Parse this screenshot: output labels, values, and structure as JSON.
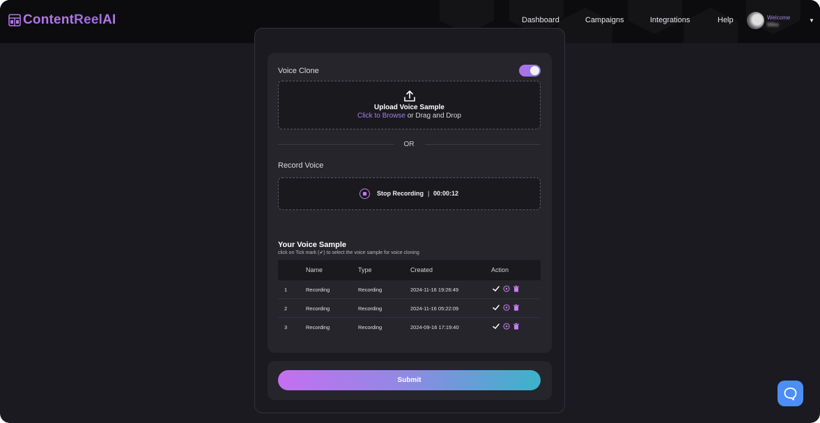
{
  "app": {
    "logo_part1": "Content",
    "logo_part2": "Reel",
    "logo_part3": "AI"
  },
  "nav": {
    "items": [
      "Dashboard",
      "Campaigns",
      "Integrations",
      "Help"
    ]
  },
  "user": {
    "welcome": "Welcome",
    "name": "Mike"
  },
  "voice_clone": {
    "label": "Voice Clone",
    "enabled": true
  },
  "upload": {
    "title": "Upload Voice Sample",
    "browse_link": "Click to Browse",
    "rest": " or Drag and Drop"
  },
  "divider": {
    "or": "OR"
  },
  "record": {
    "label": "Record Voice",
    "button_label": "Stop Recording",
    "separator": "|",
    "timer": "00:00:12"
  },
  "samples": {
    "title": "Your Voice Sample",
    "subtitle": "click on Tick mark (✔) to select the voice sample for voice cloning",
    "columns": [
      "Name",
      "Type",
      "Created",
      "Action"
    ],
    "rows": [
      {
        "index": "1",
        "name": "Recording",
        "type": "Recording",
        "created": "2024-11-16 19:26:49"
      },
      {
        "index": "2",
        "name": "Recording",
        "type": "Recording",
        "created": "2024-11-16 05:22:09"
      },
      {
        "index": "3",
        "name": "Recording",
        "type": "Recording",
        "created": "2024-09-16 17:19:40"
      }
    ]
  },
  "submit": {
    "label": "Submit"
  },
  "colors": {
    "accent": "#b276e8",
    "background": "#1b1a20",
    "card": "#26252b",
    "help_button": "#4d8ef4"
  },
  "icons": {
    "upload": "upload-icon",
    "record": "stop-record-icon",
    "select": "check-icon",
    "play": "play-icon",
    "delete": "trash-icon",
    "help": "chat-support-icon"
  }
}
